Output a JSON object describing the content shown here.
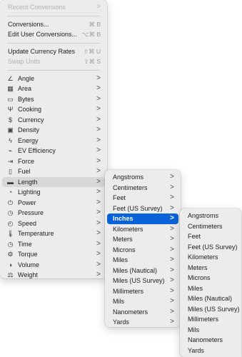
{
  "menu_top": [
    {
      "label": "Recent Conversions",
      "disabled": true,
      "chevron": true
    },
    {
      "type": "sep"
    },
    {
      "label": "Conversions...",
      "shortcut": "⌘ B"
    },
    {
      "label": "Edit User Conversions...",
      "shortcut": "⌥⌘ B"
    },
    {
      "type": "sep"
    },
    {
      "label": "Update Currency Rates",
      "shortcut": "⇧⌘ U"
    },
    {
      "label": "Swap Units",
      "disabled": true,
      "shortcut": "⇧⌘ S"
    },
    {
      "type": "sep"
    }
  ],
  "categories": [
    {
      "label": "Angle",
      "icon": "angle-icon"
    },
    {
      "label": "Area",
      "icon": "area-icon"
    },
    {
      "label": "Bytes",
      "icon": "bytes-icon"
    },
    {
      "label": "Cooking",
      "icon": "cooking-icon"
    },
    {
      "label": "Currency",
      "icon": "currency-icon"
    },
    {
      "label": "Density",
      "icon": "density-icon"
    },
    {
      "label": "Energy",
      "icon": "energy-icon"
    },
    {
      "label": "EV Efficiency",
      "icon": "ev-efficiency-icon"
    },
    {
      "label": "Force",
      "icon": "force-icon"
    },
    {
      "label": "Fuel",
      "icon": "fuel-icon"
    },
    {
      "label": "Length",
      "icon": "length-icon",
      "highlight": "gray"
    },
    {
      "label": "Lighting",
      "icon": "lighting-icon"
    },
    {
      "label": "Power",
      "icon": "power-icon"
    },
    {
      "label": "Pressure",
      "icon": "pressure-icon"
    },
    {
      "label": "Speed",
      "icon": "speed-icon"
    },
    {
      "label": "Temperature",
      "icon": "temperature-icon"
    },
    {
      "label": "Time",
      "icon": "time-icon"
    },
    {
      "label": "Torque",
      "icon": "torque-icon"
    },
    {
      "label": "Volume",
      "icon": "volume-icon"
    },
    {
      "label": "Weight",
      "icon": "weight-icon"
    }
  ],
  "length_units": [
    {
      "label": "Angstroms"
    },
    {
      "label": "Centimeters"
    },
    {
      "label": "Feet"
    },
    {
      "label": "Feet (US Survey)"
    },
    {
      "label": "Inches",
      "highlight": "blue"
    },
    {
      "label": "Kilometers"
    },
    {
      "label": "Meters"
    },
    {
      "label": "Microns"
    },
    {
      "label": "Miles"
    },
    {
      "label": "Miles (Nautical)"
    },
    {
      "label": "Miles (US Survey)"
    },
    {
      "label": "Millimeters"
    },
    {
      "label": "Mils"
    },
    {
      "label": "Nanometers"
    },
    {
      "label": "Yards"
    }
  ],
  "inches_targets": [
    "Angstroms",
    "Centimeters",
    "Feet",
    "Feet (US Survey)",
    "Kilometers",
    "Meters",
    "Microns",
    "Miles",
    "Miles (Nautical)",
    "Miles (US Survey)",
    "Millimeters",
    "Mils",
    "Nanometers",
    "Yards"
  ],
  "chevron_glyph": ">",
  "colors": {
    "menu_bg": "#ececec",
    "highlight_blue": "#0a62d8",
    "highlight_gray": "#d8d8d8"
  },
  "icon_glyphs": {
    "angle-icon": "∠",
    "area-icon": "▦",
    "bytes-icon": "▭",
    "cooking-icon": "Ψ",
    "currency-icon": "$",
    "density-icon": "▣",
    "energy-icon": "ϟ",
    "ev-efficiency-icon": "⌁",
    "force-icon": "⇥",
    "fuel-icon": "▯",
    "length-icon": "▬",
    "lighting-icon": "◔",
    "power-icon": "⏻",
    "pressure-icon": "◷",
    "speed-icon": "◴",
    "temperature-icon": "🌡",
    "time-icon": "◷",
    "torque-icon": "⚙",
    "volume-icon": "◑",
    "weight-icon": "⚖"
  }
}
